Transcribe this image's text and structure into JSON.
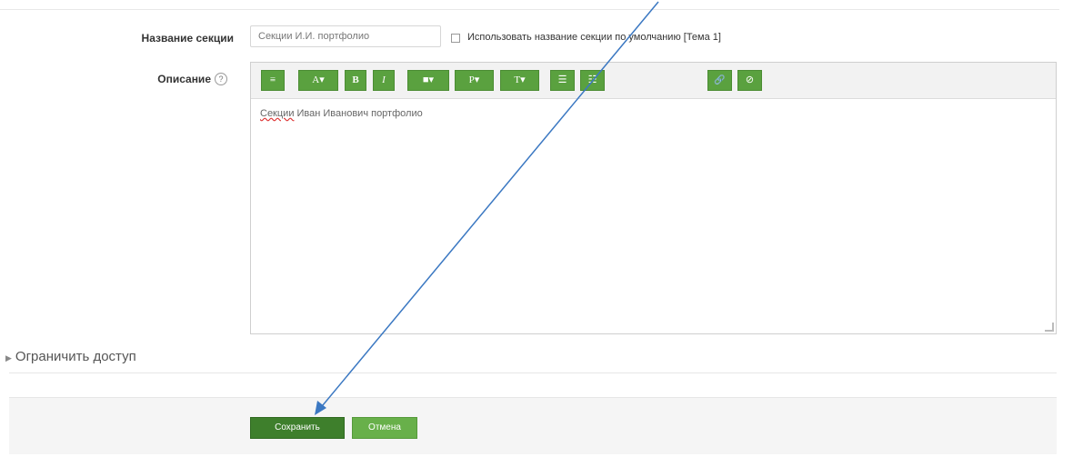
{
  "form": {
    "section_name_label": "Название секции",
    "section_name_value": "Секции И.И. портфолио",
    "use_default_label": "Использовать название секции по умолчанию [Тема 1]",
    "description_label": "Описание",
    "help_icon": "?",
    "editor_content": {
      "underlined_word": "Секции",
      "rest": " Иван Иванович портфолио"
    },
    "toolbar": [
      {
        "name": "insert-menu-icon",
        "label": "≡"
      },
      {
        "name": "text-style-icon",
        "label": "A▾"
      },
      {
        "name": "bold-icon",
        "label": "B"
      },
      {
        "name": "italic-icon",
        "label": "I"
      },
      {
        "name": "comment-icon",
        "label": "■▾"
      },
      {
        "name": "paragraph-icon",
        "label": "P▾"
      },
      {
        "name": "font-icon",
        "label": "T▾"
      },
      {
        "name": "unordered-list-icon",
        "label": "☰"
      },
      {
        "name": "ordered-list-icon",
        "label": "☷"
      },
      {
        "name": "link-icon",
        "label": "🔗"
      },
      {
        "name": "unlink-icon",
        "label": "⊘"
      }
    ]
  },
  "restrict_access": {
    "label": "Ограничить доступ"
  },
  "actions": {
    "save_label": "Сохранить",
    "cancel_label": "Отмена"
  },
  "colors": {
    "accent_green": "#5aa13f",
    "save_green": "#3e7f2c",
    "annotation_arrow": "#3b78c2"
  }
}
